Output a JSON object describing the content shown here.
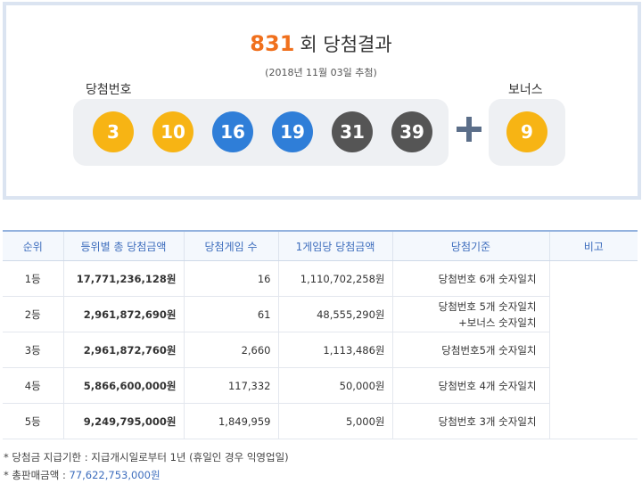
{
  "draw": {
    "round": "831",
    "title_suffix": "회 당첨결과",
    "date": "(2018년 11월 03일 추첨)",
    "winning_label": "당첨번호",
    "bonus_label": "보너스",
    "numbers": [
      "3",
      "10",
      "16",
      "19",
      "31",
      "39"
    ],
    "number_colors": [
      "#f7b414",
      "#f7b414",
      "#2f7ed8",
      "#2f7ed8",
      "#555555",
      "#555555"
    ],
    "bonus": "9",
    "bonus_color": "#f7b414"
  },
  "table": {
    "headers": [
      "순위",
      "등위별 총 당첨금액",
      "당첨게임 수",
      "1게임당 당첨금액",
      "당첨기준",
      "비고"
    ],
    "rows": [
      {
        "rank": "1등",
        "total": "17,771,236,128원",
        "games": "16",
        "per_game": "1,110,702,258원",
        "criteria": "당첨번호 6개 숫자일치",
        "criteria2": ""
      },
      {
        "rank": "2등",
        "total": "2,961,872,690원",
        "games": "61",
        "per_game": "48,555,290원",
        "criteria": "당첨번호 5개 숫자일치",
        "criteria2": "+보너스 숫자일치"
      },
      {
        "rank": "3등",
        "total": "2,961,872,760원",
        "games": "2,660",
        "per_game": "1,113,486원",
        "criteria": "당첨번호5개 숫자일치",
        "criteria2": ""
      },
      {
        "rank": "4등",
        "total": "5,866,600,000원",
        "games": "117,332",
        "per_game": "50,000원",
        "criteria": "당첨번호 4개 숫자일치",
        "criteria2": ""
      },
      {
        "rank": "5등",
        "total": "9,249,795,000원",
        "games": "1,849,959",
        "per_game": "5,000원",
        "criteria": "당첨번호 3개 숫자일치",
        "criteria2": ""
      }
    ]
  },
  "notes": {
    "payout_deadline": "* 당첨금 지급기한 : 지급개시일로부터 1년 (휴일인 경우 익영업일)",
    "total_sales_label": "* 총판매금액 : ",
    "total_sales_value": "77,622,753,000원"
  }
}
